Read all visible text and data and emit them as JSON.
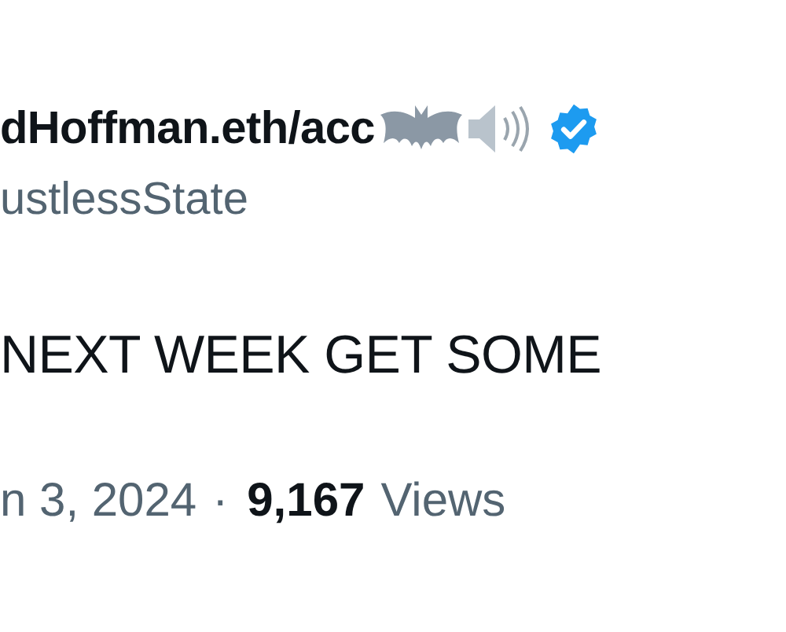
{
  "author": {
    "display_name": "dHoffman.eth/acc",
    "verified": true,
    "handle": "ustlessState"
  },
  "post": {
    "text": "NEXT WEEK GET SOME"
  },
  "meta": {
    "date": "n 3, 2024",
    "separator": "·",
    "views_count": "9,167",
    "views_label": "Views"
  }
}
